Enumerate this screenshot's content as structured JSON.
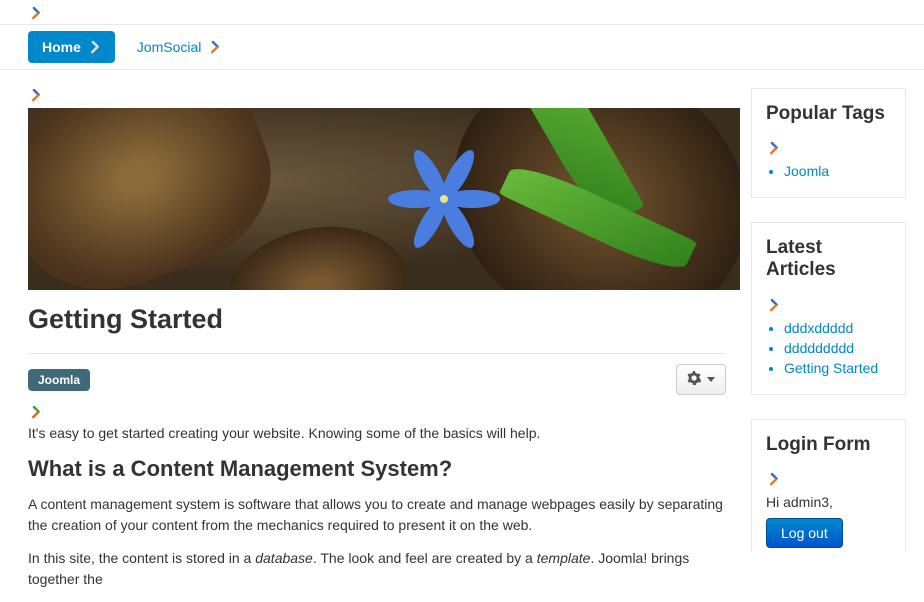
{
  "nav": {
    "items": [
      {
        "label": "Home",
        "active": true
      },
      {
        "label": "JomSocial",
        "active": false
      }
    ]
  },
  "article": {
    "title": "Getting Started",
    "tags": [
      "Joomla"
    ],
    "intro": "It's easy to get started creating your website. Knowing some of the basics will help.",
    "heading2": "What is a Content Management System?",
    "para2": "A content management system is software that allows you to create and manage webpages easily by separating the creation of your content from the mechanics required to present it on the web.",
    "para3_pre": "In this site, the content is stored in a ",
    "para3_em1": "database",
    "para3_mid": ". The look and feel are created by a ",
    "para3_em2": "template",
    "para3_post": ". Joomla! brings together the"
  },
  "sidebar": {
    "popular_tags": {
      "title": "Popular Tags",
      "items": [
        "Joomla"
      ]
    },
    "latest": {
      "title": "Latest Articles",
      "items": [
        "dddxddddd",
        "ddddddddd",
        "Getting Started"
      ]
    },
    "login": {
      "title": "Login Form",
      "greeting": "Hi admin3,",
      "button": "Log out"
    }
  }
}
